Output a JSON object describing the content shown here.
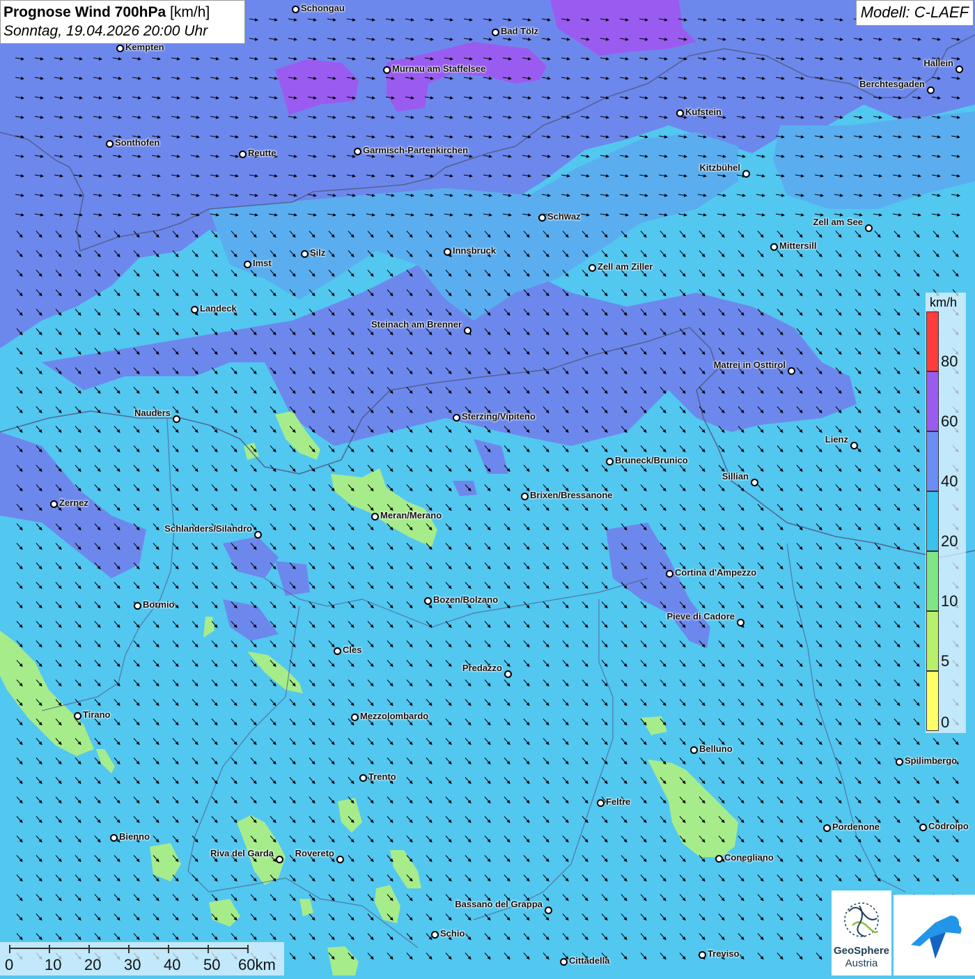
{
  "title": {
    "main": "Prognose Wind 700hPa",
    "unit": " [km/h]",
    "date": "Sonntag, 19.04.2026 20:00 Uhr"
  },
  "model": "Modell: C-LAEF",
  "legend": {
    "unit": "km/h",
    "labels": [
      "80",
      "60",
      "40",
      "20",
      "10",
      "5",
      "0"
    ],
    "colors": [
      "#ff3b3b",
      "#9a5cf0",
      "#6a8ef5",
      "#37c3ee",
      "#7ee684",
      "#b9f06a",
      "#ffff66"
    ]
  },
  "scale": {
    "labels": [
      "0",
      "10",
      "20",
      "30",
      "40",
      "50",
      "60km"
    ]
  },
  "logo": {
    "name_line1": "GeoSphere",
    "name_line2": "Austria"
  },
  "colors": {
    "sea_blue": "#52c7f0",
    "upper_blue": "#6d88ec",
    "violet": "#9a5cf0",
    "light_green": "#a6ec8b"
  },
  "cities": [
    {
      "name": "Schongau"
    },
    {
      "name": "Bad Tölz"
    },
    {
      "name": "Kempten"
    },
    {
      "name": "Murnau am Staffelsee"
    },
    {
      "name": "Hallein"
    },
    {
      "name": "Berchtesgaden"
    },
    {
      "name": "Kufstein"
    },
    {
      "name": "Sonthofen"
    },
    {
      "name": "Reutte"
    },
    {
      "name": "Garmisch-Partenkirchen"
    },
    {
      "name": "Kitzbühel"
    },
    {
      "name": "Schwaz"
    },
    {
      "name": "Zell am See"
    },
    {
      "name": "Mittersill"
    },
    {
      "name": "Innsbruck"
    },
    {
      "name": "Silz"
    },
    {
      "name": "Imst"
    },
    {
      "name": "Zell am Ziller"
    },
    {
      "name": "Landeck"
    },
    {
      "name": "Steinach am Brenner"
    },
    {
      "name": "Matrei in Osttirol"
    },
    {
      "name": "Nauders"
    },
    {
      "name": "Sterzing/Vipiteno"
    },
    {
      "name": "Lienz"
    },
    {
      "name": "Bruneck/Brunico"
    },
    {
      "name": "Sillian"
    },
    {
      "name": "Brixen/Bressanone"
    },
    {
      "name": "Zernez"
    },
    {
      "name": "Meran/Merano"
    },
    {
      "name": "Schlanders/Silandro"
    },
    {
      "name": "Cortina d'Ampezzo"
    },
    {
      "name": "Bozen/Bolzano"
    },
    {
      "name": "Bormio"
    },
    {
      "name": "Pieve di Cadore"
    },
    {
      "name": "Cles"
    },
    {
      "name": "Predazzo"
    },
    {
      "name": "Tirano"
    },
    {
      "name": "Mezzolombardo"
    },
    {
      "name": "Belluno"
    },
    {
      "name": "Spilimbergo"
    },
    {
      "name": "Trento"
    },
    {
      "name": "Feltre"
    },
    {
      "name": "Pordenone"
    },
    {
      "name": "Codroipo"
    },
    {
      "name": "Bienno"
    },
    {
      "name": "Riva del Garda"
    },
    {
      "name": "Rovereto"
    },
    {
      "name": "Conegliano"
    },
    {
      "name": "Bassano del Grappa"
    },
    {
      "name": "Schio"
    },
    {
      "name": "Treviso"
    },
    {
      "name": "Cittadella"
    }
  ]
}
